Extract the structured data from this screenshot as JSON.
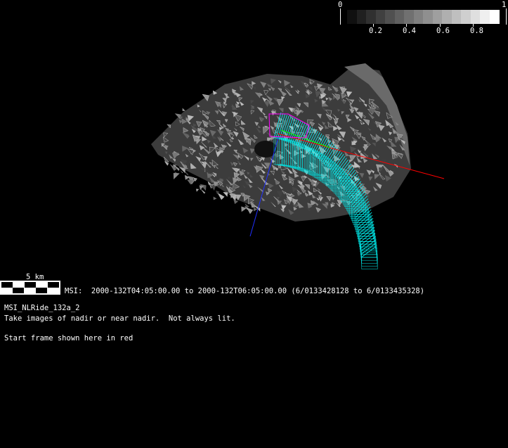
{
  "colorbar": {
    "min_label": "0",
    "max_label": "1",
    "tick_labels": [
      "0.2",
      "0.4",
      "0.6",
      "0.8"
    ],
    "tick_values": [
      0.2,
      0.4,
      0.6,
      0.8
    ],
    "steps": 16
  },
  "scale_bar": {
    "label": "5 km"
  },
  "observation": {
    "time_range": "MSI:  2000-132T04:05:00.00 to 2000-132T06:05:00.00 (6/0133428128 to 6/0133435328)",
    "name": "MSI_NLRide_132a_2",
    "description": "Take images of nadir or near nadir.  Not always lit.",
    "note": "Start frame shown here in red"
  },
  "colors": {
    "swath": "#00ffff",
    "start_frame": "#ff0000",
    "axis_blue": "#0000ff",
    "boresight": "#ff00ff"
  }
}
